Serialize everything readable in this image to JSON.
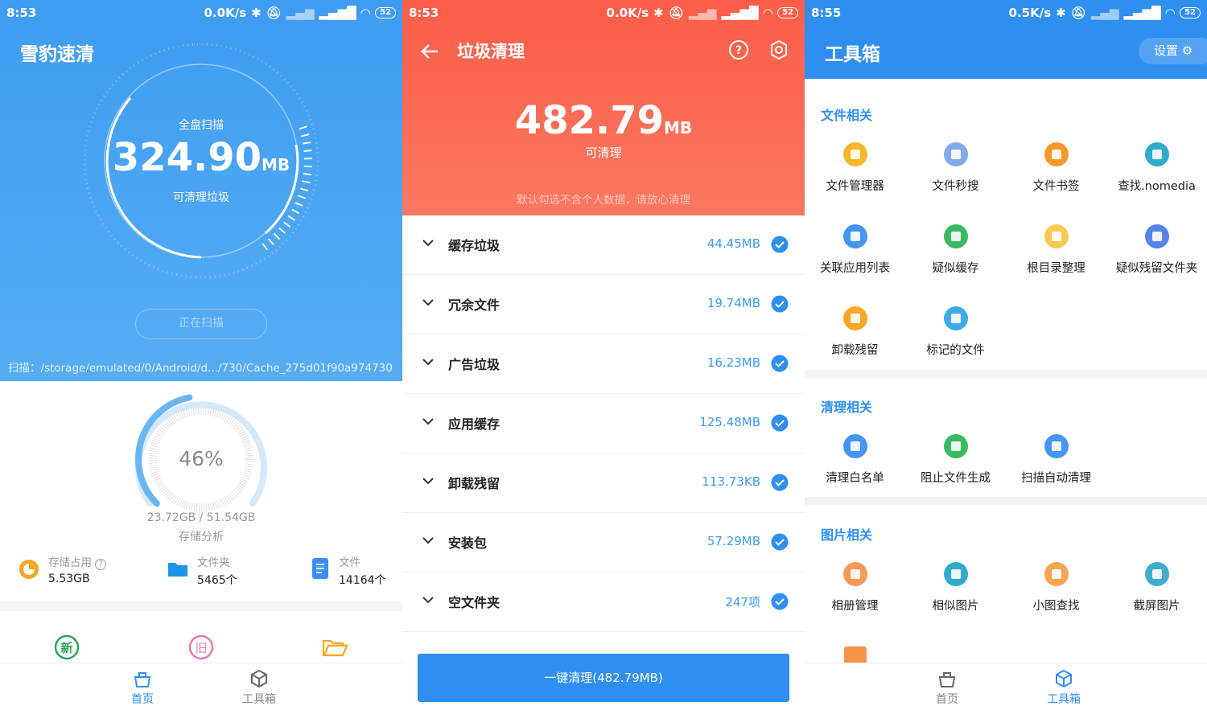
{
  "screen1": {
    "status": {
      "time": "8:53",
      "net": "0.0K/s",
      "battery": "52"
    },
    "title": "雪豹速清",
    "scan_label": "全盘扫描",
    "size_value": "324.90",
    "size_unit": "MB",
    "size_caption": "可清理垃圾",
    "scan_button": "正在扫描",
    "scan_path": "扫描：/storage/emulated/0/Android/d.../730/Cache_275d01f90a974730",
    "storage_percent": "46%",
    "storage_percent_value": 46,
    "storage_used": "23.72GB / 51.54GB",
    "storage_analysis": "存储分析",
    "stats": [
      {
        "label": "存储占用",
        "value": "5.53GB",
        "icon": "pie-chart-icon"
      },
      {
        "label": "文件夹",
        "value": "5465个",
        "icon": "folder-icon"
      },
      {
        "label": "文件",
        "value": "14164个",
        "icon": "document-icon"
      }
    ],
    "quick_icons": [
      "new-files-icon",
      "old-files-icon",
      "open-folder-icon"
    ],
    "quick_texts": [
      "新",
      "旧"
    ],
    "tabs": [
      {
        "label": "首页",
        "active": true
      },
      {
        "label": "工具箱",
        "active": false
      }
    ]
  },
  "screen2": {
    "status": {
      "time": "8:53",
      "net": "0.0K/s",
      "battery": "52"
    },
    "title": "垃圾清理",
    "size_value": "482.79",
    "size_unit": "MB",
    "size_caption": "可清理",
    "note": "默认勾选不含个人数据，请放心清理",
    "items": [
      {
        "name": "缓存垃圾",
        "amount": "44.45MB"
      },
      {
        "name": "冗余文件",
        "amount": "19.74MB"
      },
      {
        "name": "广告垃圾",
        "amount": "16.23MB"
      },
      {
        "name": "应用缓存",
        "amount": "125.48MB"
      },
      {
        "name": "卸载残留",
        "amount": "113.73KB"
      },
      {
        "name": "安装包",
        "amount": "57.29MB"
      },
      {
        "name": "空文件夹",
        "amount": "247项"
      }
    ],
    "clean_button": "一键清理(482.79MB)"
  },
  "screen3": {
    "status": {
      "time": "8:55",
      "net": "0.5K/s",
      "battery": "52"
    },
    "title": "工具箱",
    "settings": "设置",
    "sections": [
      {
        "title": "文件相关",
        "tools": [
          {
            "label": "文件管理器",
            "icon": "file-manager-icon",
            "color": "#f9b21a"
          },
          {
            "label": "文件秒搜",
            "icon": "file-search-icon",
            "color": "#7aa7e8"
          },
          {
            "label": "文件书签",
            "icon": "bookmark-icon",
            "color": "#f7941d"
          },
          {
            "label": "查找.nomedia",
            "icon": "nomedia-icon",
            "color": "#24a8c9"
          },
          {
            "label": "关联应用列表",
            "icon": "linked-apps-icon",
            "color": "#3b8ff3"
          },
          {
            "label": "疑似缓存",
            "icon": "broom-icon",
            "color": "#2fb55b"
          },
          {
            "label": "根目录整理",
            "icon": "root-folder-icon",
            "color": "#fbc54a"
          },
          {
            "label": "疑似残留文件夹",
            "icon": "residual-folder-icon",
            "color": "#4c7de8"
          },
          {
            "label": "卸载残留",
            "icon": "uninstall-residue-icon",
            "color": "#f7a21f"
          },
          {
            "label": "标记的文件",
            "icon": "marked-files-icon",
            "color": "#37a7e8"
          }
        ]
      },
      {
        "title": "清理相关",
        "tools": [
          {
            "label": "清理白名单",
            "icon": "whitelist-icon",
            "color": "#3b8ff3"
          },
          {
            "label": "阻止文件生成",
            "icon": "block-file-icon",
            "color": "#2fb55b"
          },
          {
            "label": "扫描自动清理",
            "icon": "auto-clean-icon",
            "color": "#3b8ff3"
          }
        ]
      },
      {
        "title": "图片相关",
        "tools": [
          {
            "label": "相册管理",
            "icon": "album-icon",
            "color": "#f7944a"
          },
          {
            "label": "相似图片",
            "icon": "similar-image-icon",
            "color": "#27a6c9"
          },
          {
            "label": "小图查找",
            "icon": "small-image-icon",
            "color": "#f7a24a"
          },
          {
            "label": "截屏图片",
            "icon": "screenshot-icon",
            "color": "#3aa6c9"
          }
        ]
      }
    ],
    "tabs": [
      {
        "label": "首页",
        "active": false
      },
      {
        "label": "工具箱",
        "active": true
      }
    ]
  },
  "colors": {
    "blue": "#2f8ff0",
    "red": "#fb5d48",
    "text": "#222222",
    "grey": "#9a9a9a"
  }
}
